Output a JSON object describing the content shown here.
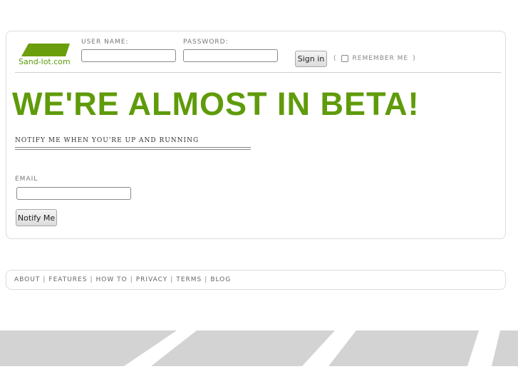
{
  "logo": {
    "text": "Sand-lot.com",
    "color": "#6b9e0c"
  },
  "login": {
    "username_label": "USER NAME:",
    "username_value": "",
    "password_label": "PASSWORD:",
    "password_value": "",
    "signin_label": "Sign in",
    "remember_open": "(",
    "remember_label": "REMEMBER ME",
    "remember_close": ")",
    "remember_checked": false
  },
  "main": {
    "headline": "WE'RE ALMOST IN BETA!",
    "headline_color": "#5f9b0a",
    "notify_heading": "NOTIFY ME WHEN YOU'RE UP AND RUNNING",
    "email_label": "EMAIL",
    "email_value": "",
    "notify_button": "Notify Me"
  },
  "footer": {
    "links": [
      "ABOUT",
      "FEATURES",
      "HOW TO",
      "PRIVACY",
      "TERMS",
      "BLOG"
    ],
    "separator": "|"
  },
  "decoration": {
    "stripe_color": "#d3d3d3"
  }
}
